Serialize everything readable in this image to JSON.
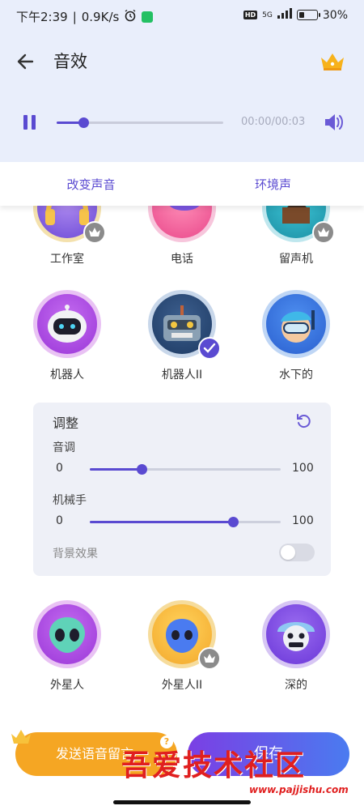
{
  "status_bar": {
    "time": "下午2:39",
    "network_speed": "0.9K/s",
    "hd": "HD",
    "network": "5G",
    "battery": "30%",
    "battery_level": 0.3
  },
  "header": {
    "title": "音效",
    "back_icon": "arrow-left-icon",
    "crown_icon": "crown-icon"
  },
  "player": {
    "state": "playing",
    "progress": 0.16,
    "time": "00:00/00:03",
    "volume_icon": "speaker-icon"
  },
  "tabs": [
    {
      "label": "改变声音",
      "active": true
    },
    {
      "label": "环境声",
      "active": false
    }
  ],
  "effects": [
    {
      "label": "工作室",
      "locked": true,
      "selected": false
    },
    {
      "label": "电话",
      "locked": false,
      "selected": false
    },
    {
      "label": "留声机",
      "locked": true,
      "selected": false
    },
    {
      "label": "机器人",
      "locked": false,
      "selected": false
    },
    {
      "label": "机器人II",
      "locked": false,
      "selected": true
    },
    {
      "label": "水下的",
      "locked": false,
      "selected": false
    },
    {
      "label": "外星人",
      "locked": false,
      "selected": false
    },
    {
      "label": "外星人II",
      "locked": true,
      "selected": false
    },
    {
      "label": "深的",
      "locked": false,
      "selected": false
    }
  ],
  "adjust": {
    "title": "调整",
    "pitch": {
      "label": "音调",
      "min": "0",
      "max": "100",
      "value": 27
    },
    "mechanical": {
      "label": "机械手",
      "min": "0",
      "max": "100",
      "value": 75
    },
    "background": {
      "label": "背景效果",
      "on": false
    }
  },
  "bottom": {
    "send_label": "发送语音留言",
    "help": "?",
    "save_label": "保存",
    "watermark": "吾爱技术社区",
    "watermark_url": "www.pajjishu.com"
  },
  "colors": {
    "accent": "#5a4ad1",
    "header_bg": "#e9eefb",
    "send": "#f5a623"
  }
}
